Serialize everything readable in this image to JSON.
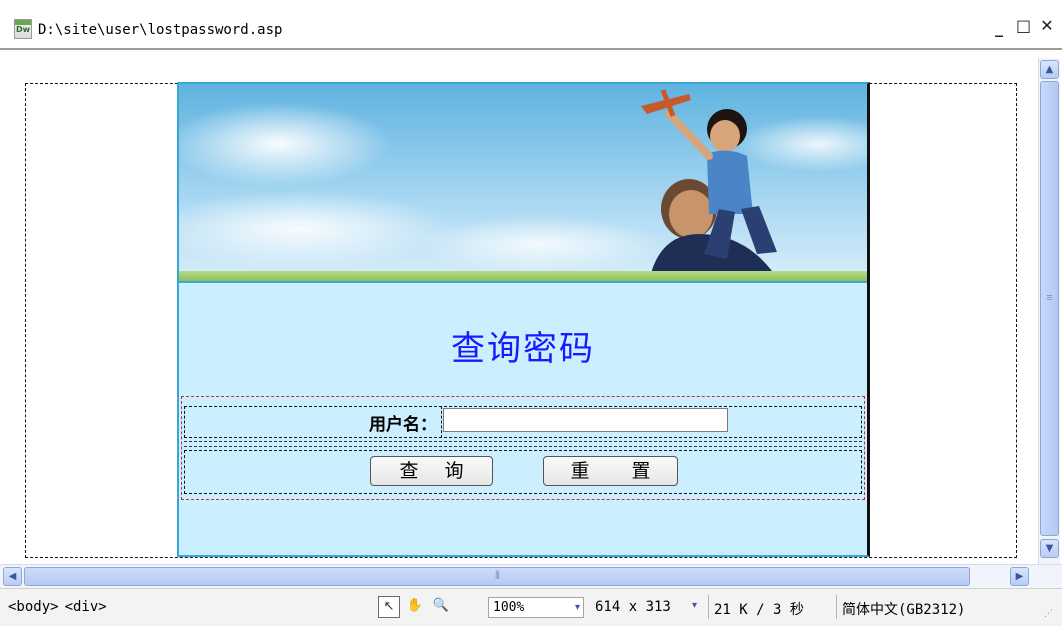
{
  "window": {
    "file_path": "D:\\site\\user\\lostpassword.asp",
    "app_icon_label": "Dw",
    "minimize": "_",
    "maximize": "□",
    "close": "✕"
  },
  "page": {
    "heading": "查询密码",
    "form": {
      "username_label": "用户名：",
      "username_value": "",
      "query_button": "查 询",
      "reset_button": "重 置"
    }
  },
  "scrollbars": {
    "up": "▲",
    "down": "▼",
    "left": "◀",
    "right": "▶"
  },
  "statusbar": {
    "tags": [
      "<body>",
      "<div>"
    ],
    "tools": {
      "select": "↖",
      "hand": "✋",
      "zoom": "🔍"
    },
    "zoom": "100%",
    "dropdown_arrow": "▾",
    "window_size": "614 x 313",
    "download": "21 K / 3 秒",
    "encoding": "简体中文(GB2312)",
    "grip": "⋰"
  }
}
